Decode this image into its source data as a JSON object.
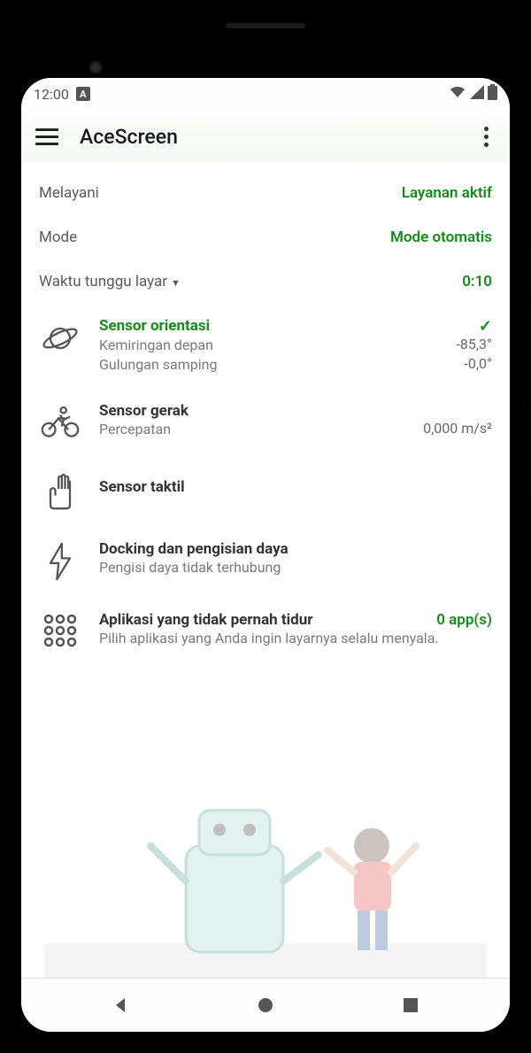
{
  "status_bar": {
    "time": "12:00",
    "auto_rotate_badge": "A"
  },
  "header": {
    "title": "AceScreen"
  },
  "rows": {
    "service_label": "Melayani",
    "service_value": "Layanan aktif",
    "mode_label": "Mode",
    "mode_value": "Mode otomatis",
    "timeout_label": "Waktu tunggu layar",
    "timeout_value": "0:10"
  },
  "orientation": {
    "title": "Sensor orientasi",
    "tilt_label": "Kemiringan depan",
    "tilt_value": "-85,3°",
    "roll_label": "Gulungan samping",
    "roll_value": "-0,0°",
    "active_check": "✓"
  },
  "motion": {
    "title": "Sensor gerak",
    "accel_label": "Percepatan",
    "accel_value": "0,000 m/s²"
  },
  "touch": {
    "title": "Sensor taktil"
  },
  "docking": {
    "title": "Docking dan pengisian daya",
    "sub": "Pengisi daya tidak terhubung"
  },
  "apps": {
    "title": "Aplikasi yang tidak pernah tidur",
    "count": "0 app(s)",
    "sub": "Pilih aplikasi yang Anda ingin layarnya selalu menyala."
  }
}
